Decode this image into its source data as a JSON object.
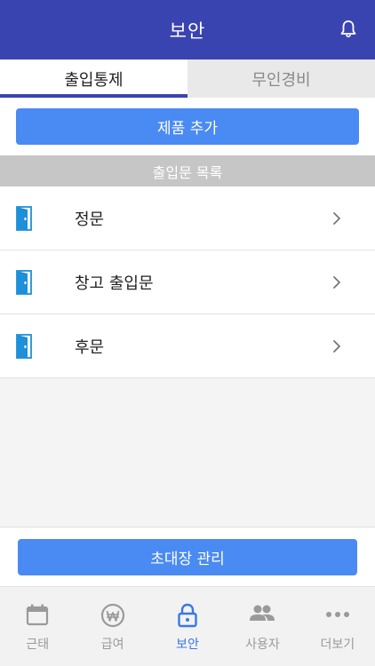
{
  "header": {
    "title": "보안"
  },
  "tabs": [
    {
      "label": "출입통제",
      "active": true
    },
    {
      "label": "무인경비",
      "active": false
    }
  ],
  "add_button": "제품 추가",
  "section_title": "출입문 목록",
  "doors": [
    {
      "name": "정문"
    },
    {
      "name": "창고 출입문"
    },
    {
      "name": "후문"
    }
  ],
  "invite_button": "초대장 관리",
  "tabbar": [
    {
      "label": "근태",
      "icon": "calendar-icon",
      "active": false
    },
    {
      "label": "급여",
      "icon": "won-icon",
      "active": false
    },
    {
      "label": "보안",
      "icon": "lock-icon",
      "active": true
    },
    {
      "label": "사용자",
      "icon": "users-icon",
      "active": false
    },
    {
      "label": "더보기",
      "icon": "more-icon",
      "active": false
    }
  ],
  "colors": {
    "primary": "#3a44b0",
    "button": "#4a8af3",
    "active_tab": "#3a78e6",
    "door": "#1e8fd8"
  }
}
